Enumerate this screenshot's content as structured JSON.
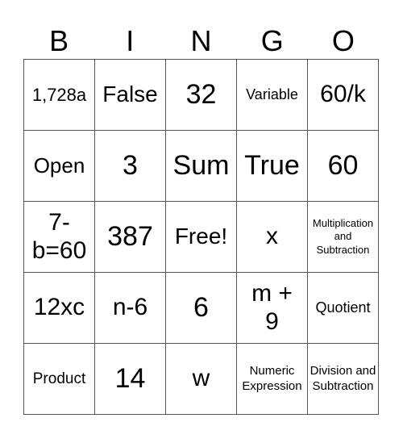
{
  "header": [
    "B",
    "I",
    "N",
    "G",
    "O"
  ],
  "cells": [
    [
      "1,728a",
      "False",
      "32",
      "Variable",
      "60/k"
    ],
    [
      "Open",
      "3",
      "Sum",
      "True",
      "60"
    ],
    [
      "7-\nb=60",
      "387",
      "Free!",
      "x",
      "Multiplication and Subtraction"
    ],
    [
      "12xc",
      "n-6",
      "6",
      "m +\n9",
      "Quotient"
    ],
    [
      "Product",
      "14",
      "w",
      "Numeric Expression",
      "Division and Subtraction"
    ]
  ],
  "colors": {
    "grid_line": "#555555",
    "text": "#000000",
    "background": "#ffffff"
  }
}
